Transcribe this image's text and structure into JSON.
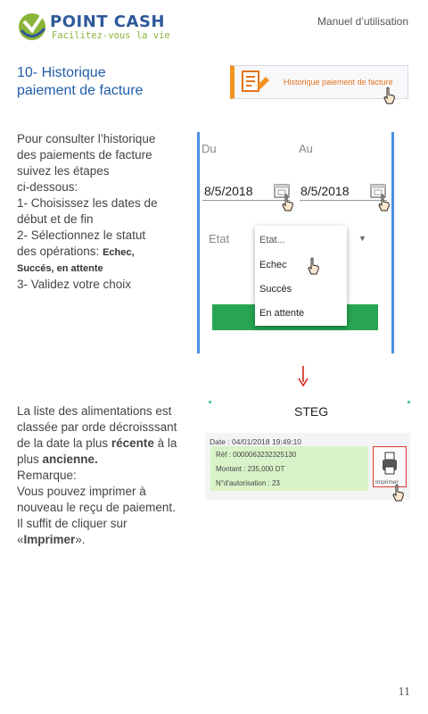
{
  "header": {
    "brand": "POINT CASH",
    "tagline": "Facilitez-vous la vie",
    "manual_label": "Manuel d’utilisation"
  },
  "section": {
    "title_line1": "10- Historique",
    "title_line2": "paiement de facture",
    "button_label": "Historique paiement de facture"
  },
  "instructions": {
    "lines": [
      "Pour consulter l’historique",
      "des paiements de facture",
      "suivez les étapes",
      "ci-dessous:",
      "1- Choisissez les dates de",
      "début et de fin",
      "2- Sélectionnez le statut",
      "des opérations: "
    ],
    "statuses_inline": "Echec,",
    "statuses_line2": "Succés, en attente",
    "step3": "3- Validez votre choix"
  },
  "filter_screen": {
    "from_label": "Du",
    "to_label": "Au",
    "from_date": "8/5/2018",
    "to_date": "8/5/2018",
    "status_label": "Etat",
    "dropdown": [
      "Etat...",
      "Echec",
      "Succès",
      "En attente"
    ]
  },
  "explanation": {
    "l1": "La liste des alimentations est",
    "l2": "classée par orde  décroisssant",
    "l3a": "de la date la plus ",
    "l3b": "récente",
    "l3c": " à la",
    "l4a": "plus ",
    "l4b": "ancienne.",
    "l5": "Remarque:",
    "l6": "Vous pouvez imprimer à",
    "l7": "nouveau le reçu de paiement.",
    "l8": "Il suffit de cliquer sur",
    "l9a": "«",
    "l9b": "Imprimer",
    "l9c": "»."
  },
  "history_screen": {
    "title": "STEG",
    "date": "Date : 04/01/2018 19:49:10",
    "ref": "Réf : 0000063232325130",
    "amount": "Montant : 235,000 DT",
    "auth": "N°d'autorisation : 23",
    "print_label": "Imprimer"
  },
  "page_number": "11",
  "colors": {
    "brand_blue": "#2e5a9a",
    "brand_green": "#8ab33a",
    "accent_orange": "#f39322",
    "action_green": "#27a552",
    "status_red": "#d9261c"
  }
}
